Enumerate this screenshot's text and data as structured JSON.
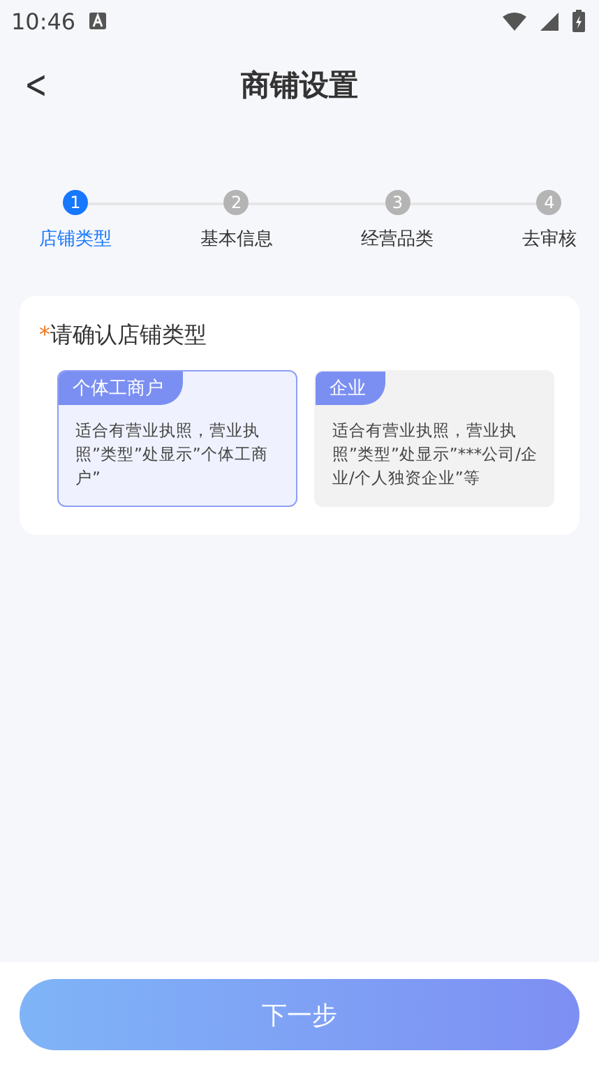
{
  "status_bar": {
    "time": "10:46"
  },
  "header": {
    "back": "<",
    "title": "商铺设置"
  },
  "steps": [
    {
      "number": "1",
      "label": "店铺类型",
      "selected": true
    },
    {
      "number": "2",
      "label": "基本信息",
      "selected": false
    },
    {
      "number": "3",
      "label": "经营品类",
      "selected": false
    },
    {
      "number": "4",
      "label": "去审核",
      "selected": false
    }
  ],
  "form": {
    "required_mark": "*",
    "label": "请确认店铺类型",
    "options": [
      {
        "tag": "个体工商户",
        "description": "适合有营业执照，营业执照”类型”处显示”个体工商户”",
        "selected": true
      },
      {
        "tag": "企业",
        "description": "适合有营业执照，营业执照”类型”处显示”***公司/企业/个人独资企业”等",
        "selected": false
      }
    ]
  },
  "next_button": "下一步"
}
